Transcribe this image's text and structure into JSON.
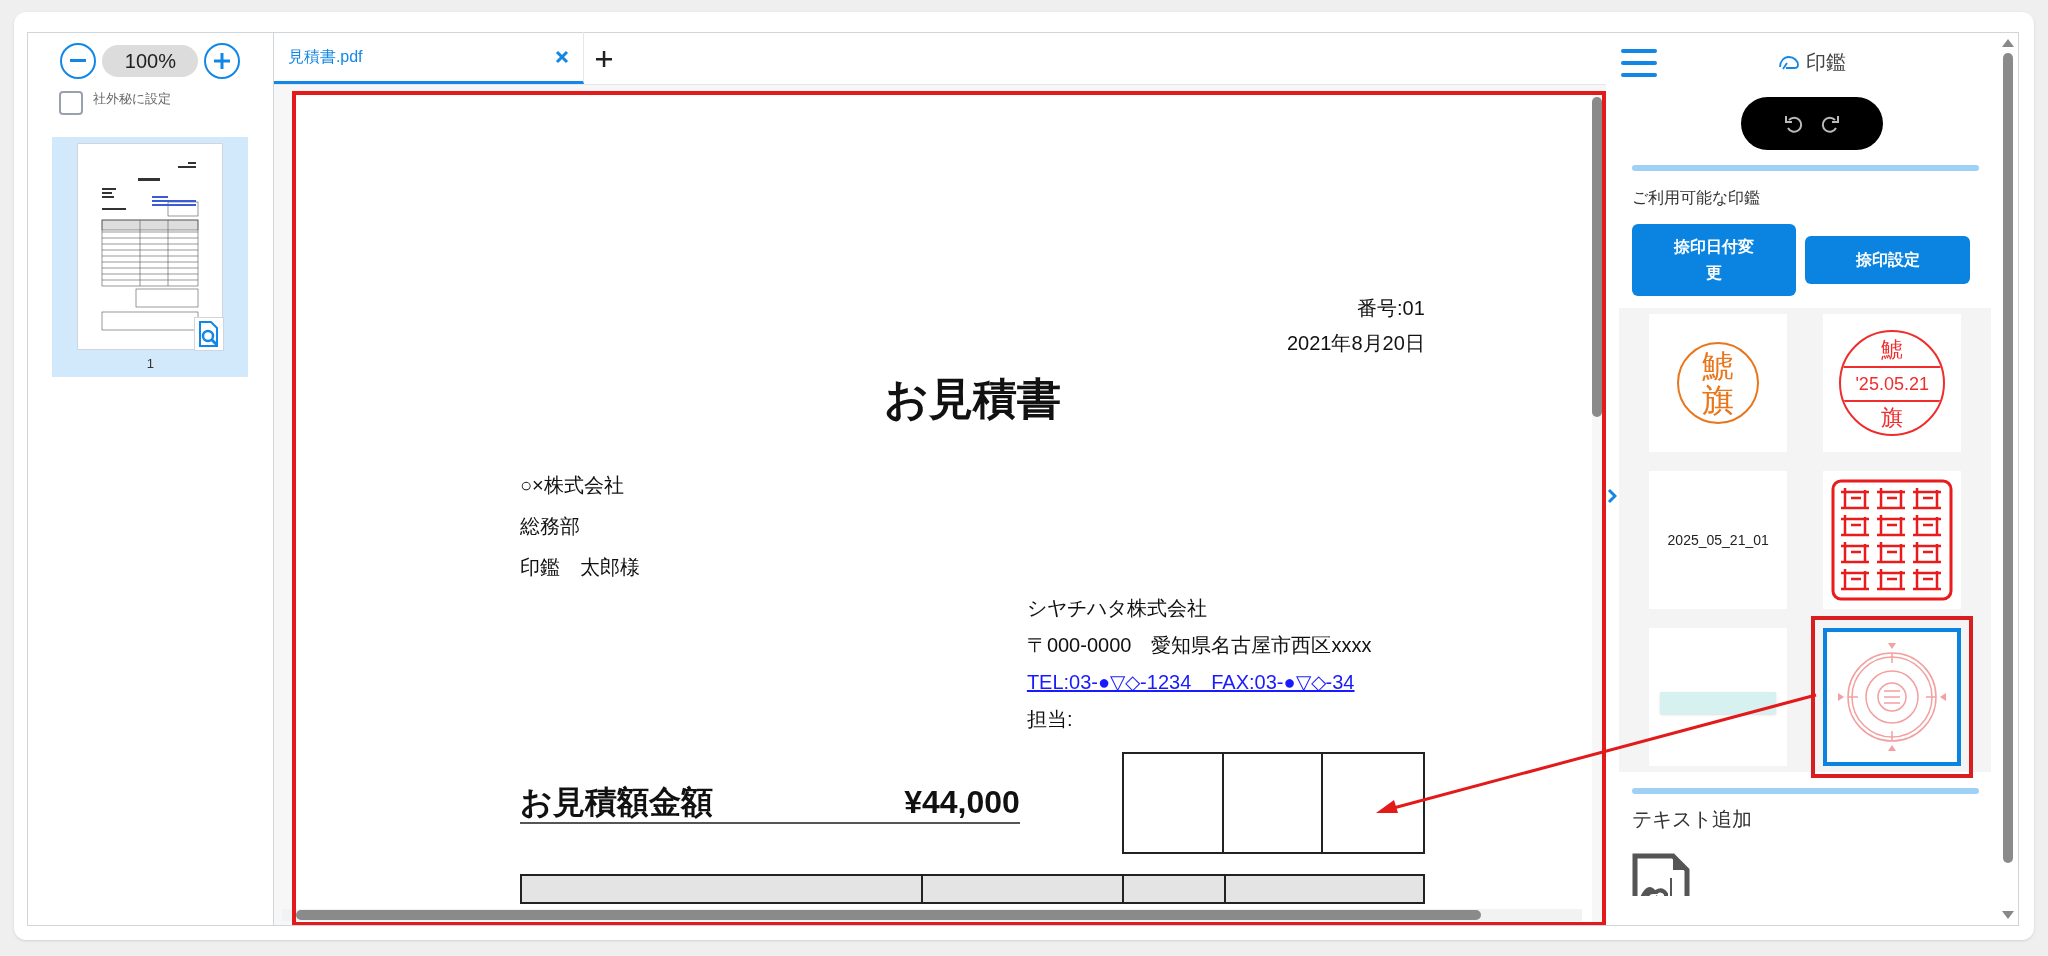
{
  "zoom": {
    "value": "100%"
  },
  "confidential": {
    "label": "社外秘に設定",
    "checked": false
  },
  "thumbnails": [
    {
      "page": "1",
      "selected": true
    }
  ],
  "tabs": [
    {
      "label": "見積書.pdf",
      "selected": true
    }
  ],
  "document": {
    "number": "番号:01",
    "date": "2021年8月20日",
    "title": "お見積書",
    "recipient": [
      "○×株式会社",
      "総務部",
      "印鑑　太郎様"
    ],
    "sender": {
      "company": "シヤチハタ株式会社",
      "address": "〒000-0000　愛知県名古屋市西区xxxx",
      "contact": "TEL:03-●▽◇-1234　FAX:03-●▽◇-34",
      "person": "担当:"
    },
    "amount_label": "お見積額金額",
    "amount": "¥44,000"
  },
  "panel": {
    "title": "印鑑",
    "section": "ご利用可能な印鑑",
    "buttons": [
      "捺印日付変更",
      "捺印設定"
    ],
    "stamps": [
      {
        "kind": "name",
        "chars": [
          "鯱",
          "旗"
        ],
        "color": "#e8761c",
        "selected": false
      },
      {
        "kind": "date",
        "chars": [
          "鯱",
          "'25.05.21",
          "旗"
        ],
        "color": "#ef2d2d",
        "selected": false
      },
      {
        "kind": "text",
        "chars": [
          "2025_05_21_01"
        ],
        "selected": false
      },
      {
        "kind": "seal",
        "color": "#e81c1c",
        "selected": false
      },
      {
        "kind": "blank",
        "color": "#d6f1f0",
        "selected": false
      },
      {
        "kind": "round-seal",
        "color": "#f2a0a0",
        "selected": true
      }
    ],
    "text_section": "テキスト追加"
  }
}
